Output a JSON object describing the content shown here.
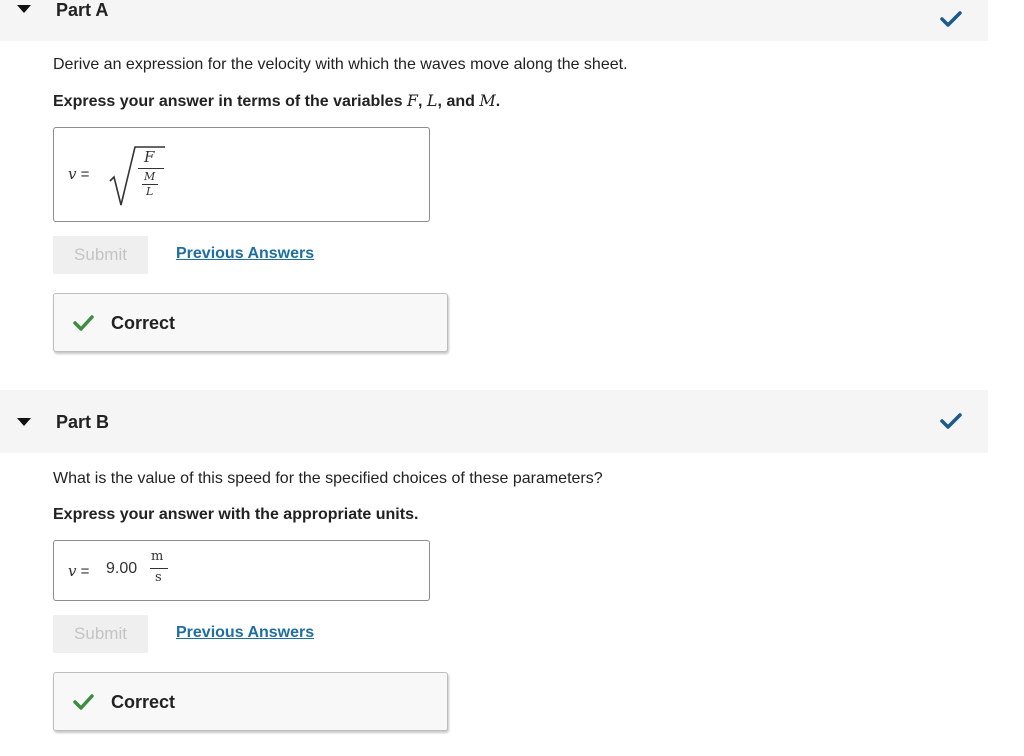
{
  "colors": {
    "header_bg": "#f5f5f5",
    "head_check": "#1c5a8a",
    "correct_check": "#3d8c40",
    "link": "#1e6ea0",
    "submit_disabled_text": "#c4c4c4"
  },
  "part_a": {
    "title": "Part A",
    "status_icon": "check-icon",
    "prompt": "Derive an expression for the velocity with which the waves move along the sheet.",
    "instruction_prefix": "Express your answer in terms of the variables ",
    "var_f": "F",
    "comma_1": ", ",
    "var_l": "L",
    "and_text": ", and ",
    "var_m": "M",
    "period": ".",
    "answer": {
      "lhs": "v",
      "equals": "=",
      "sqrt_num": "F",
      "inner_num": "M",
      "inner_den": "L"
    },
    "submit_label": "Submit",
    "previous_answers_label": "Previous Answers",
    "feedback_label": "Correct"
  },
  "part_b": {
    "title": "Part B",
    "status_icon": "check-icon",
    "prompt": "What is the value of this speed for the specified choices of these parameters?",
    "instruction": "Express your answer with the appropriate units.",
    "answer": {
      "lhs": "v",
      "equals": "=",
      "value": "9.00",
      "unit_num": "m",
      "unit_den": "s"
    },
    "submit_label": "Submit",
    "previous_answers_label": "Previous Answers",
    "feedback_label": "Correct"
  }
}
